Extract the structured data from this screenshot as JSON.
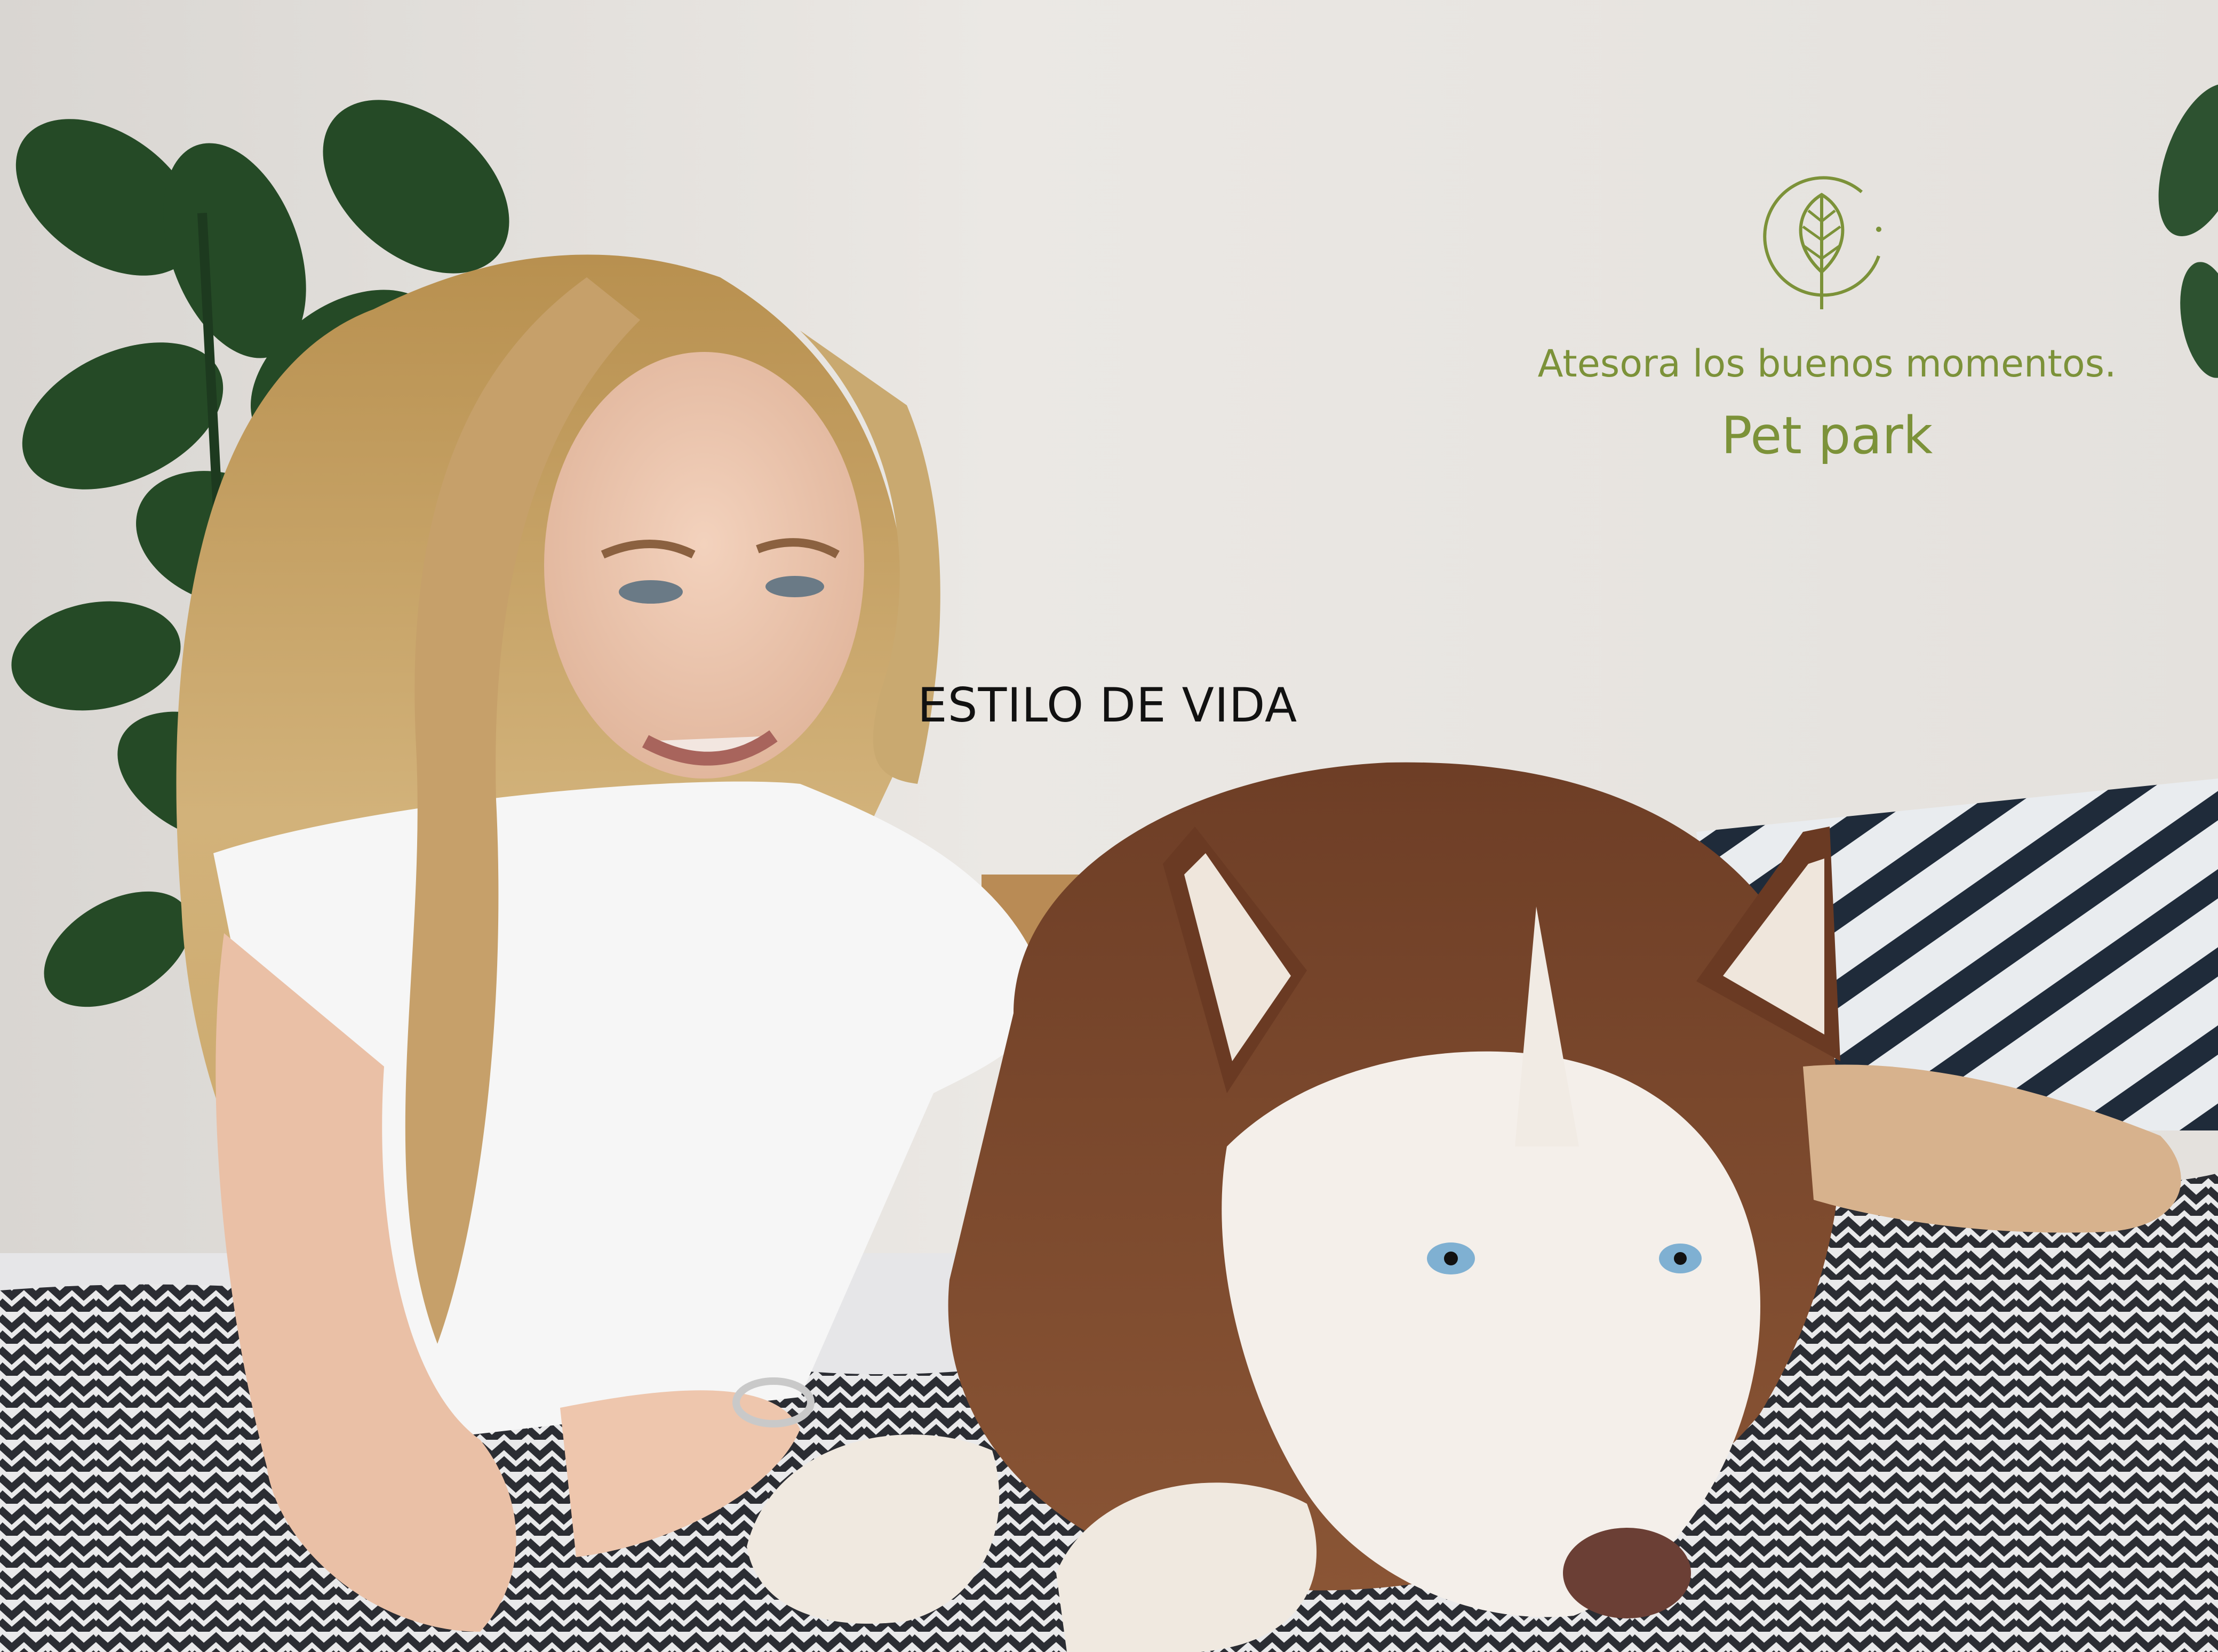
{
  "photo": {
    "subject": "photo-woman-and-husky",
    "icons": {
      "logo": "leaf-circle-logo-icon"
    }
  },
  "brand": {
    "tagline": "Atesora los buenos momentos.",
    "name": "Pet park"
  },
  "overlay": {
    "headline": "ESTILO DE VIDA"
  },
  "colors": {
    "brand_green": "#7c9239",
    "headline_text": "#111111",
    "wall": "#e7e4e0",
    "tshirt": "#f7f7f7",
    "blanket_dark": "#2b2d33"
  }
}
